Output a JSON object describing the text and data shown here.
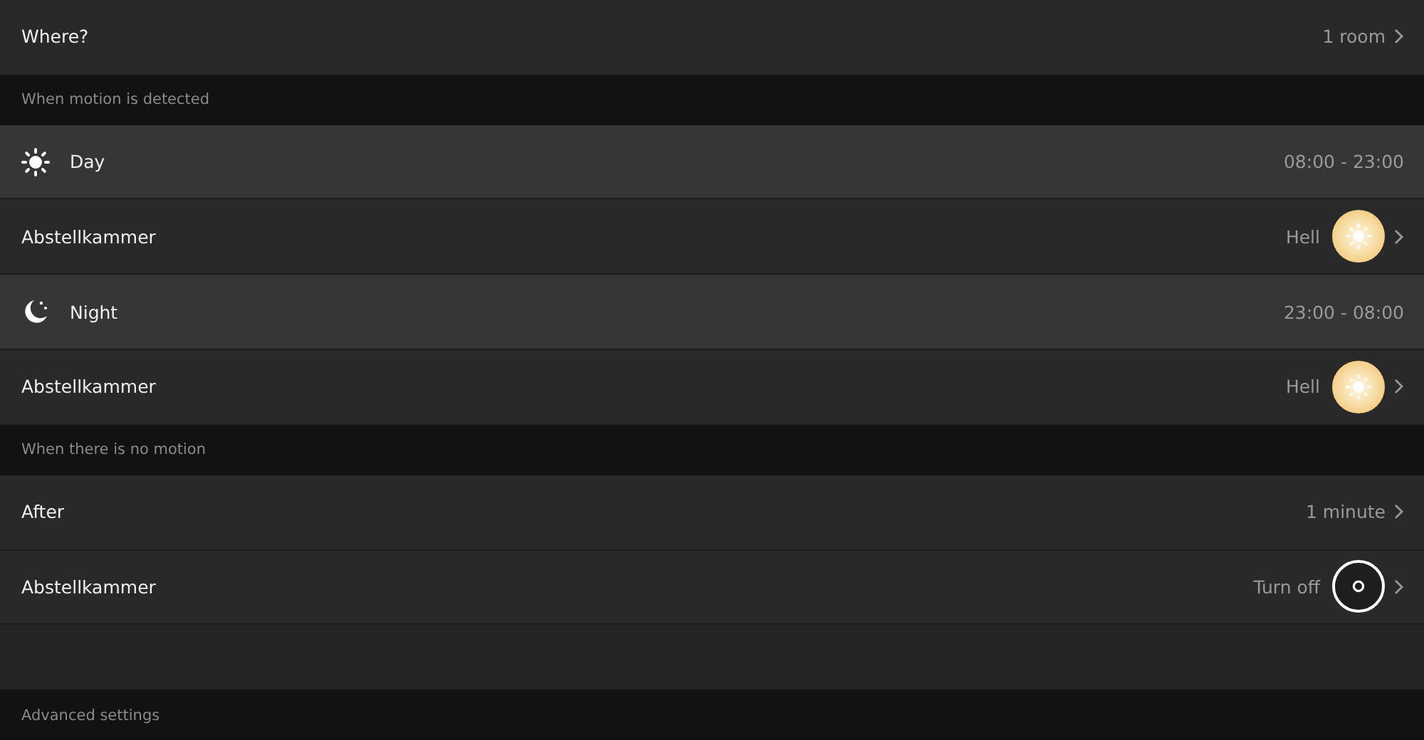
{
  "sections": [
    {
      "rows": [
        {
          "kind": "nav",
          "label": "Where?",
          "value": "1 room"
        }
      ]
    },
    {
      "header": "When motion is detected",
      "rows": [
        {
          "kind": "day",
          "label": "Day",
          "value": "08:00 - 23:00"
        },
        {
          "kind": "bright",
          "label": "Abstellkammer",
          "value": "Hell"
        },
        {
          "kind": "night",
          "label": "Night",
          "value": "23:00 - 08:00"
        },
        {
          "kind": "bright",
          "label": "Abstellkammer",
          "value": "Hell"
        }
      ]
    },
    {
      "header": "When there is no motion",
      "rows": [
        {
          "kind": "nav",
          "label": "After",
          "value": "1 minute"
        },
        {
          "kind": "off",
          "label": "Abstellkammer",
          "value": "Turn off"
        },
        {
          "kind": "empty"
        }
      ]
    },
    {
      "header": "Advanced settings"
    }
  ]
}
